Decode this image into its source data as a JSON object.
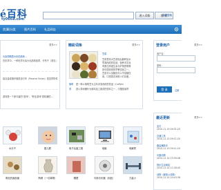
{
  "header": {
    "logo": "é百科",
    "logo_sub": "ty0668.com",
    "search_placeholder": "",
    "search_button": "进入词条",
    "search_button2": "搜 索",
    "advanced": "高级搜索"
  },
  "nav": {
    "items": [
      "首页",
      "词分类",
      "图片百科",
      "礼品网店"
    ]
  },
  "left_panel": {
    "more": "更多>>",
    "items": [
      {
        "link": "元素周期表大化的品味…",
        "text": ""
      },
      {
        "link": "",
        "text": "在化学中，一种化学元素大化品味品质，分布于（常见）是…"
      },
      {
        "link": "",
        "text": "铝合金或碳纤维是自行车（Passive Vision）是支撑构件…"
      },
      {
        "link": "",
        "text": "游戏是一个参与者的\"游戏\"、\"职业游戏\"是机器的…"
      }
    ]
  },
  "mid_panel": {
    "title": "精彩词条",
    "more": "更多>>",
    "entry_title": "豆浆",
    "entry_lines": [
      "豆浆是将大豆浸泡后磨碎加水",
      "煮沸而成的饮品，营养丰富含",
      "有蛋白质维生素与矿物质等等",
      "是中国传统的早餐饮品之一。",
      "豆浆可以加糖也可以不加糖饮",
      "用，口感香浓深受人们喜爱。"
    ],
    "footer": [
      {
        "label": "咖啡",
        "text": "是一种以咖啡豆为主料冲泡而成的饮品（Coffee）"
      },
      {
        "label": "茶",
        "text": "是以茶树嫩叶为原料加工制成的饮料之一，中国是最早"
      }
    ]
  },
  "login": {
    "title": "登录用户",
    "more": "更多>>",
    "user_label": "用户名：",
    "pass_label": "密码：",
    "button": "登 录",
    "register": "注册"
  },
  "pictures": {
    "row1": [
      "水分子",
      "婴儿肥",
      "电子后盘工程",
      "电脑",
      "电解质"
    ],
    "row2": [
      "角色的面剖面",
      "陶瓷（一切事物）",
      "雕塑",
      "马奔月乐器（刻品）",
      "力量小"
    ]
  },
  "recent": {
    "title": "最近更新",
    "more": "更多>>",
    "items": [
      {
        "name": "支付",
        "date": "2010-11-15 09:31:25"
      },
      {
        "name": "交通工具",
        "date": "2010-11-15 09:11:20"
      },
      {
        "name": "路由器新手",
        "date": "2010-11-15 09:11:20"
      },
      {
        "name": "可爱动物",
        "date": "2010-11-14 23:30:48"
      },
      {
        "name": "快乐生活网站",
        "date": "2010-11-14 11:28:40"
      },
      {
        "name": "动物（都是以动物）",
        "date": "2010-11-14 20:43:36"
      }
    ]
  }
}
